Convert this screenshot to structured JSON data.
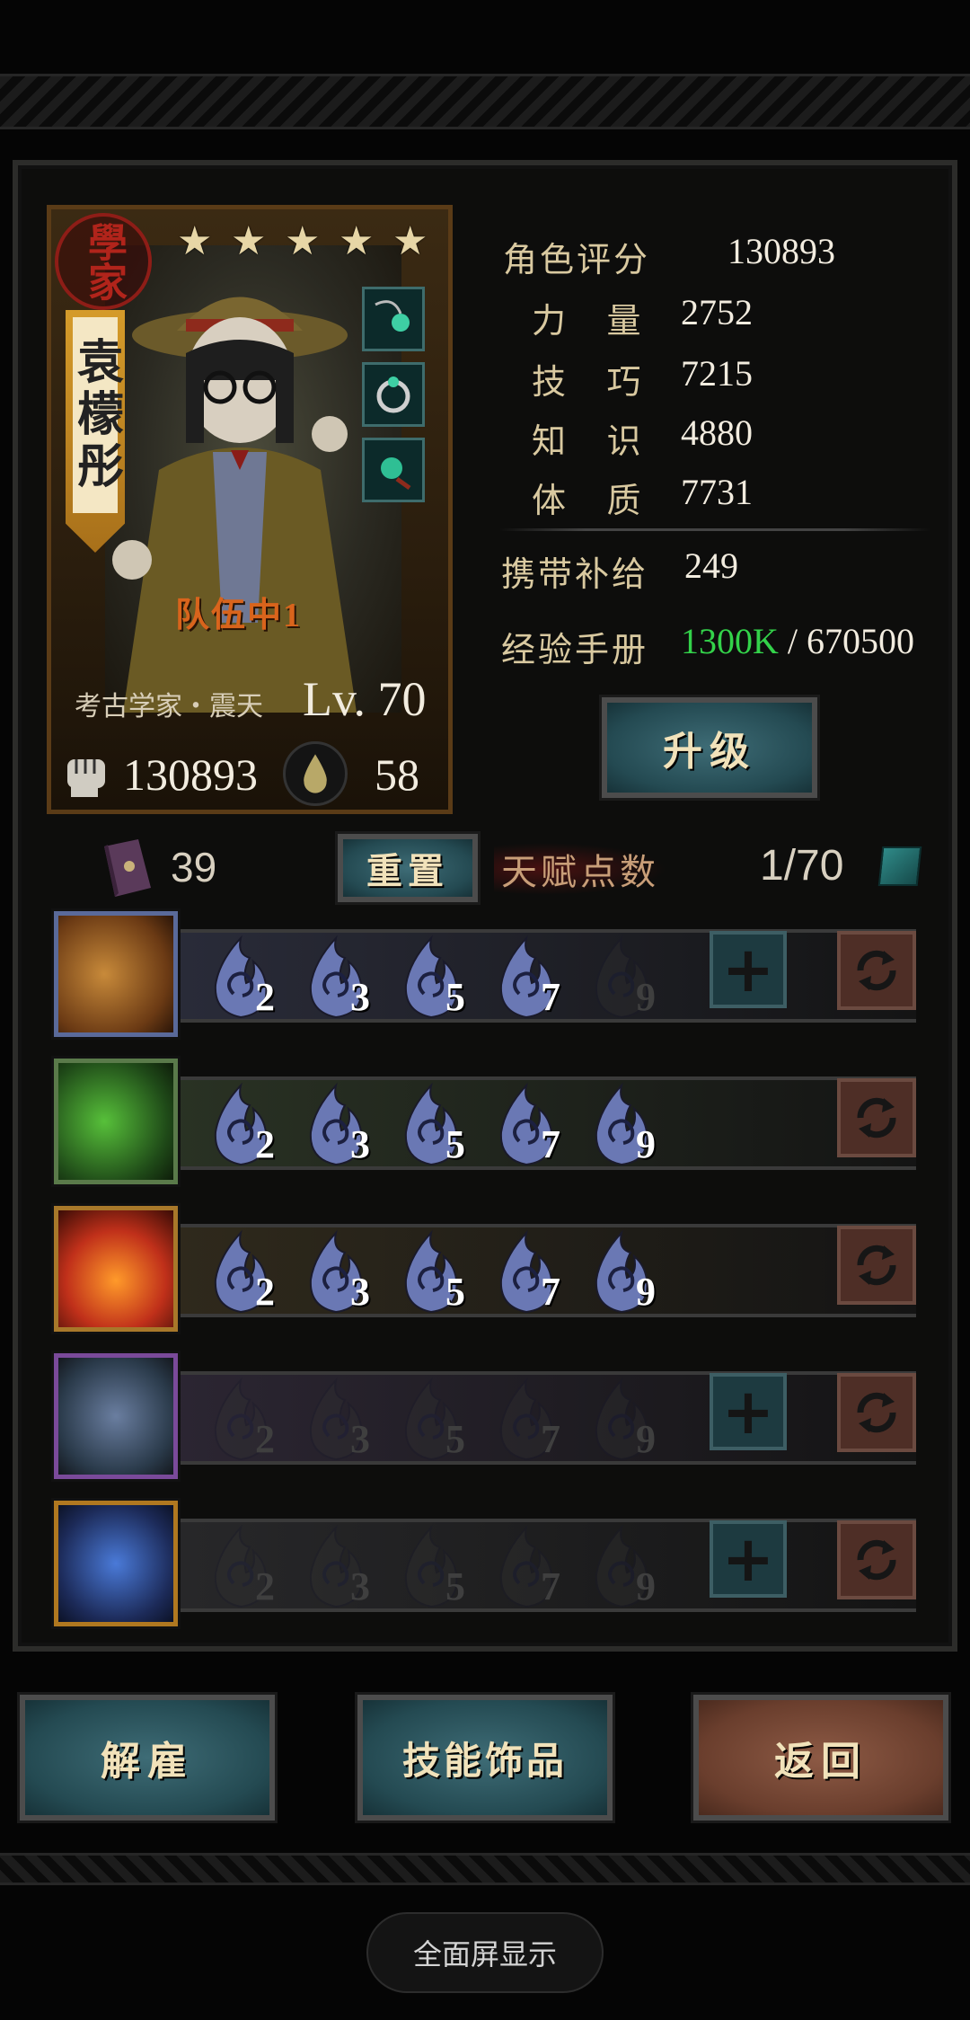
{
  "character": {
    "class_seal": "學家",
    "name": "袁檬彤",
    "stars": [
      "★",
      "★",
      "★",
      "★",
      "★"
    ],
    "team_label": "队伍中1",
    "subtitle": "考古学家・震天",
    "level": "Lv. 70",
    "power": "130893",
    "supply": "58"
  },
  "stats": {
    "rating_label": "角色评分",
    "rating_value": "130893",
    "strength_label": "力 量",
    "strength_value": "2752",
    "skill_label": "技 巧",
    "skill_value": "7215",
    "knowledge_label": "知 识",
    "knowledge_value": "4880",
    "constitution_label": "体 质",
    "constitution_value": "7731",
    "carry_label": "携带补给",
    "carry_value": "249",
    "exp_label": "经验手册",
    "exp_current": "1300K",
    "exp_total": " / 670500",
    "upgrade_label": "升级"
  },
  "talents": {
    "book_count": "39",
    "reset_label": "重置",
    "points_label": "天赋点数",
    "points_value": "1/70"
  },
  "skills": [
    {
      "levels": [
        "2",
        "3",
        "5",
        "7",
        "9"
      ],
      "filled": 4,
      "has_plus": true
    },
    {
      "levels": [
        "2",
        "3",
        "5",
        "7",
        "9"
      ],
      "filled": 5,
      "has_plus": false
    },
    {
      "levels": [
        "2",
        "3",
        "5",
        "7",
        "9"
      ],
      "filled": 5,
      "has_plus": false
    },
    {
      "levels": [
        "2",
        "3",
        "5",
        "7",
        "9"
      ],
      "filled": 0,
      "has_plus": true
    },
    {
      "levels": [
        "2",
        "3",
        "5",
        "7",
        "9"
      ],
      "filled": 0,
      "has_plus": true
    }
  ],
  "actions": {
    "dismiss_label": "解雇",
    "skill_items_label": "技能饰品",
    "back_label": "返回"
  },
  "system": {
    "fullscreen_label": "全面屏显示"
  },
  "colors": {
    "exp_green": "#33d24a",
    "flame_blue": "#6a78b4",
    "accent_gold": "#d9c9a0"
  },
  "icons": {
    "skill_1": "feather-claw-icon",
    "skill_2": "green-fist-icon",
    "skill_3": "fire-icon",
    "skill_4": "veiled-figure-icon",
    "skill_5": "blue-muscle-icon"
  }
}
